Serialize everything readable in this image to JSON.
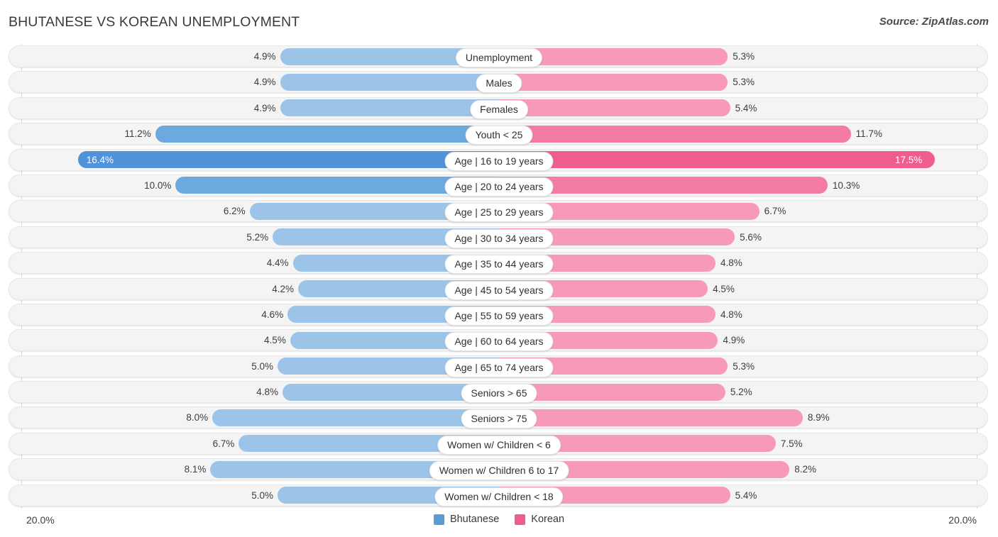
{
  "header": {
    "title": "BHUTANESE VS KOREAN UNEMPLOYMENT",
    "source": "Source: ZipAtlas.com"
  },
  "axis": {
    "left_label": "20.0%",
    "right_label": "20.0%"
  },
  "legend": {
    "items": [
      {
        "label": "Bhutanese",
        "color": "#5b9bd5"
      },
      {
        "label": "Korean",
        "color": "#ef5d90"
      }
    ]
  },
  "colors": {
    "bhutanese_light": "#9cc3e8",
    "bhutanese_mid": "#6ca9df",
    "bhutanese_strong": "#5093d8",
    "korean_light": "#f79ab8",
    "korean_mid": "#f47ba4",
    "korean_strong": "#ef5d90",
    "track": "#f4f4f4",
    "gridline": "#d8d8d8"
  },
  "chart_data": {
    "type": "bar",
    "subtype": "diverging-bidirectional",
    "title": "BHUTANESE VS KOREAN UNEMPLOYMENT",
    "xlabel": "",
    "ylabel": "",
    "xlim": [
      20.0,
      20.0
    ],
    "axis_max_percent": 20.0,
    "grid": true,
    "legend_position": "bottom-center",
    "categories": [
      "Unemployment",
      "Males",
      "Females",
      "Youth < 25",
      "Age | 16 to 19 years",
      "Age | 20 to 24 years",
      "Age | 25 to 29 years",
      "Age | 30 to 34 years",
      "Age | 35 to 44 years",
      "Age | 45 to 54 years",
      "Age | 55 to 59 years",
      "Age | 60 to 64 years",
      "Age | 65 to 74 years",
      "Seniors > 65",
      "Seniors > 75",
      "Women w/ Children < 6",
      "Women w/ Children 6 to 17",
      "Women w/ Children < 18"
    ],
    "series": [
      {
        "name": "Bhutanese",
        "side": "left",
        "color": "#9cc3e8",
        "values": [
          4.9,
          4.9,
          4.9,
          11.2,
          16.4,
          10.0,
          6.2,
          5.2,
          4.4,
          4.2,
          4.6,
          4.5,
          5.0,
          4.8,
          8.0,
          6.7,
          8.1,
          5.0
        ],
        "labels": [
          "4.9%",
          "4.9%",
          "4.9%",
          "11.2%",
          "16.4%",
          "10.0%",
          "6.2%",
          "5.2%",
          "4.4%",
          "4.2%",
          "4.6%",
          "4.5%",
          "5.0%",
          "4.8%",
          "8.0%",
          "6.7%",
          "8.1%",
          "5.0%"
        ]
      },
      {
        "name": "Korean",
        "side": "right",
        "color": "#f79ab8",
        "values": [
          5.3,
          5.3,
          5.4,
          11.7,
          17.5,
          10.3,
          6.7,
          5.6,
          4.8,
          4.5,
          4.8,
          4.9,
          5.3,
          5.2,
          8.9,
          7.5,
          8.2,
          5.4
        ],
        "labels": [
          "5.3%",
          "5.3%",
          "5.4%",
          "11.7%",
          "17.5%",
          "10.3%",
          "6.7%",
          "5.6%",
          "4.8%",
          "4.5%",
          "4.8%",
          "4.9%",
          "5.3%",
          "5.2%",
          "8.9%",
          "7.5%",
          "8.2%",
          "5.4%"
        ]
      }
    ]
  },
  "rows": [
    {
      "category": "Unemployment",
      "left_value": 4.9,
      "left_label": "4.9%",
      "right_value": 5.3,
      "right_label": "5.3%",
      "emphasis": 0
    },
    {
      "category": "Males",
      "left_value": 4.9,
      "left_label": "4.9%",
      "right_value": 5.3,
      "right_label": "5.3%",
      "emphasis": 0
    },
    {
      "category": "Females",
      "left_value": 4.9,
      "left_label": "4.9%",
      "right_value": 5.4,
      "right_label": "5.4%",
      "emphasis": 0
    },
    {
      "category": "Youth < 25",
      "left_value": 11.2,
      "left_label": "11.2%",
      "right_value": 11.7,
      "right_label": "11.7%",
      "emphasis": 1
    },
    {
      "category": "Age | 16 to 19 years",
      "left_value": 16.4,
      "left_label": "16.4%",
      "right_value": 17.5,
      "right_label": "17.5%",
      "emphasis": 2
    },
    {
      "category": "Age | 20 to 24 years",
      "left_value": 10.0,
      "left_label": "10.0%",
      "right_value": 10.3,
      "right_label": "10.3%",
      "emphasis": 1
    },
    {
      "category": "Age | 25 to 29 years",
      "left_value": 6.2,
      "left_label": "6.2%",
      "right_value": 6.7,
      "right_label": "6.7%",
      "emphasis": 0
    },
    {
      "category": "Age | 30 to 34 years",
      "left_value": 5.2,
      "left_label": "5.2%",
      "right_value": 5.6,
      "right_label": "5.6%",
      "emphasis": 0
    },
    {
      "category": "Age | 35 to 44 years",
      "left_value": 4.4,
      "left_label": "4.4%",
      "right_value": 4.8,
      "right_label": "4.8%",
      "emphasis": 0
    },
    {
      "category": "Age | 45 to 54 years",
      "left_value": 4.2,
      "left_label": "4.2%",
      "right_value": 4.5,
      "right_label": "4.5%",
      "emphasis": 0
    },
    {
      "category": "Age | 55 to 59 years",
      "left_value": 4.6,
      "left_label": "4.6%",
      "right_value": 4.8,
      "right_label": "4.8%",
      "emphasis": 0
    },
    {
      "category": "Age | 60 to 64 years",
      "left_value": 4.5,
      "left_label": "4.5%",
      "right_value": 4.9,
      "right_label": "4.9%",
      "emphasis": 0
    },
    {
      "category": "Age | 65 to 74 years",
      "left_value": 5.0,
      "left_label": "5.0%",
      "right_value": 5.3,
      "right_label": "5.3%",
      "emphasis": 0
    },
    {
      "category": "Seniors > 65",
      "left_value": 4.8,
      "left_label": "4.8%",
      "right_value": 5.2,
      "right_label": "5.2%",
      "emphasis": 0
    },
    {
      "category": "Seniors > 75",
      "left_value": 8.0,
      "left_label": "8.0%",
      "right_value": 8.9,
      "right_label": "8.9%",
      "emphasis": 0
    },
    {
      "category": "Women w/ Children < 6",
      "left_value": 6.7,
      "left_label": "6.7%",
      "right_value": 7.5,
      "right_label": "7.5%",
      "emphasis": 0
    },
    {
      "category": "Women w/ Children 6 to 17",
      "left_value": 8.1,
      "left_label": "8.1%",
      "right_value": 8.2,
      "right_label": "8.2%",
      "emphasis": 0
    },
    {
      "category": "Women w/ Children < 18",
      "left_value": 5.0,
      "left_label": "5.0%",
      "right_value": 5.4,
      "right_label": "5.4%",
      "emphasis": 0
    }
  ]
}
